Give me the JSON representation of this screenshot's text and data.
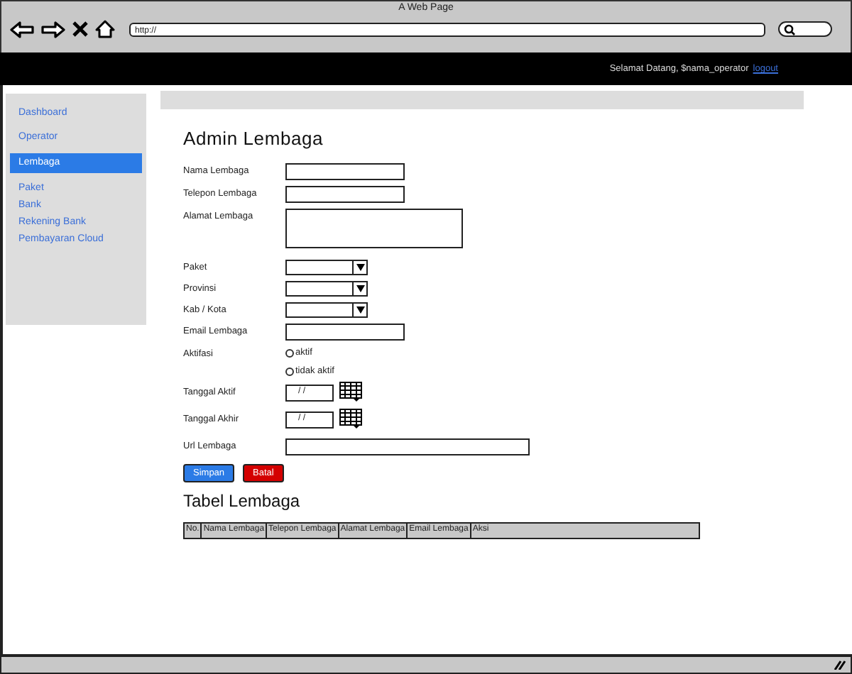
{
  "browser": {
    "title": "A Web Page",
    "url": "http://"
  },
  "header": {
    "greeting": "Selamat Datang, $nama_operator",
    "logout": "logout"
  },
  "sidebar": {
    "items": [
      {
        "label": "Dashboard",
        "selected": false
      },
      {
        "label": "Operator",
        "selected": false
      },
      {
        "label": "Lembaga",
        "selected": true
      },
      {
        "label": "Paket",
        "selected": false
      },
      {
        "label": "Bank",
        "selected": false
      },
      {
        "label": "Rekening Bank",
        "selected": false
      },
      {
        "label": "Pembayaran Cloud",
        "selected": false
      }
    ]
  },
  "form": {
    "title": "Admin Lembaga",
    "fields": [
      {
        "kind": "text",
        "label": "Nama Lembaga"
      },
      {
        "kind": "text",
        "label": "Telepon Lembaga"
      },
      {
        "kind": "textarea",
        "label": "Alamat Lembaga"
      },
      {
        "kind": "select",
        "label": "Paket"
      },
      {
        "kind": "select",
        "label": "Provinsi"
      },
      {
        "kind": "select",
        "label": "Kab / Kota"
      },
      {
        "kind": "text",
        "label": "Email Lembaga"
      },
      {
        "kind": "radio",
        "label": "Aktifasi",
        "options": [
          {
            "label": "aktif",
            "selected": false
          },
          {
            "label": "tidak aktif",
            "selected": false
          }
        ]
      },
      {
        "kind": "date",
        "label": "Tanggal Aktif",
        "value": "/ /"
      },
      {
        "kind": "date",
        "label": "Tanggal Akhir",
        "value": "/ /"
      },
      {
        "kind": "wide",
        "label": "Url Lembaga"
      }
    ],
    "buttons": [
      {
        "label": "Simpan",
        "kind": "primary"
      },
      {
        "label": "Batal",
        "kind": "danger"
      }
    ]
  },
  "table": {
    "title": "Tabel Lembaga",
    "columns": [
      "No.",
      "Nama Lembaga",
      "Telepon Lembaga",
      "Alamat Lembaga",
      "Email Lembaga",
      "Aksi"
    ]
  }
}
